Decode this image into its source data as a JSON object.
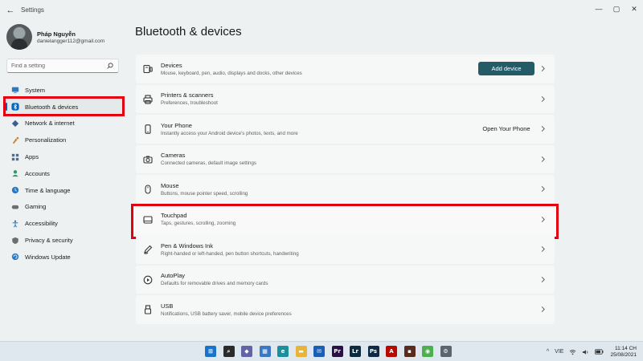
{
  "window": {
    "title": "Settings",
    "back_glyph": "←",
    "minimize_glyph": "—",
    "maximize_glyph": "▢",
    "close_glyph": "✕"
  },
  "profile": {
    "name": "Pháp Nguyễn",
    "email": "danielangger112@gmail.com"
  },
  "search": {
    "placeholder": "Find a setting"
  },
  "sidebar": {
    "items": [
      {
        "label": "System",
        "icon": "system-icon",
        "color": "#2b79c2"
      },
      {
        "label": "Bluetooth & devices",
        "icon": "bluetooth-icon",
        "color": "#0067c0",
        "selected": true
      },
      {
        "label": "Network & internet",
        "icon": "network-icon",
        "color": "#3a5f8c"
      },
      {
        "label": "Personalization",
        "icon": "personalization-icon",
        "color": "#c5892e"
      },
      {
        "label": "Apps",
        "icon": "apps-icon",
        "color": "#4f6d8c"
      },
      {
        "label": "Accounts",
        "icon": "accounts-icon",
        "color": "#2f9a6a"
      },
      {
        "label": "Time & language",
        "icon": "time-language-icon",
        "color": "#2b79c2"
      },
      {
        "label": "Gaming",
        "icon": "gaming-icon",
        "color": "#6c6f72"
      },
      {
        "label": "Accessibility",
        "icon": "accessibility-icon",
        "color": "#2b79c2"
      },
      {
        "label": "Privacy & security",
        "icon": "privacy-icon",
        "color": "#6c6f72"
      },
      {
        "label": "Windows Update",
        "icon": "windows-update-icon",
        "color": "#2b79c2"
      }
    ]
  },
  "main": {
    "title": "Bluetooth & devices",
    "cards": [
      {
        "title": "Devices",
        "desc": "Mouse, keyboard, pen, audio, displays and docks, other devices",
        "icon": "devices-icon",
        "button": "Add device",
        "button_style": "accent"
      },
      {
        "title": "Printers & scanners",
        "desc": "Preferences, troubleshoot",
        "icon": "printer-icon"
      },
      {
        "title": "Your Phone",
        "desc": "Instantly access your Android device's photos, texts, and more",
        "icon": "phone-icon",
        "button": "Open Your Phone",
        "button_style": "plain"
      },
      {
        "title": "Cameras",
        "desc": "Connected cameras, default image settings",
        "icon": "camera-icon"
      },
      {
        "title": "Mouse",
        "desc": "Buttons, mouse pointer speed, scrolling",
        "icon": "mouse-icon"
      },
      {
        "title": "Touchpad",
        "desc": "Taps, gestures, scrolling, zooming",
        "icon": "touchpad-icon",
        "highlighted": true
      },
      {
        "title": "Pen & Windows Ink",
        "desc": "Right-handed or left-handed, pen button shortcuts, handwriting",
        "icon": "pen-icon"
      },
      {
        "title": "AutoPlay",
        "desc": "Defaults for removable drives and memory cards",
        "icon": "autoplay-icon"
      },
      {
        "title": "USB",
        "desc": "Notifications, USB battery saver, mobile device preferences",
        "icon": "usb-icon"
      }
    ]
  },
  "taskbar": {
    "apps": [
      {
        "name": "start-icon",
        "color": "#1a73c8",
        "glyph": "⊞"
      },
      {
        "name": "taskbar-search-icon",
        "color": "#2b2b2b",
        "glyph": "⌕"
      },
      {
        "name": "teams-chat-icon",
        "color": "#6264a7",
        "glyph": "◆"
      },
      {
        "name": "widgets-icon",
        "color": "#3b78c2",
        "glyph": "▦"
      },
      {
        "name": "edge-icon",
        "color": "#1b8f9c",
        "glyph": "e"
      },
      {
        "name": "file-explorer-icon",
        "color": "#e8b33a",
        "glyph": "▬"
      },
      {
        "name": "mail-icon",
        "color": "#1a5fb4",
        "glyph": "✉"
      },
      {
        "name": "premiere-icon",
        "color": "#2a1143",
        "glyph": "Pr"
      },
      {
        "name": "lightroom-icon",
        "color": "#0e2a3d",
        "glyph": "Lr"
      },
      {
        "name": "photoshop-icon",
        "color": "#0f2a45",
        "glyph": "Ps"
      },
      {
        "name": "acrobat-icon",
        "color": "#b30b00",
        "glyph": "A"
      },
      {
        "name": "app-icon",
        "color": "#5b2a1e",
        "glyph": "▪"
      },
      {
        "name": "chrome-icon",
        "color": "#4caf50",
        "glyph": "◉"
      },
      {
        "name": "settings-app-icon",
        "color": "#5a6570",
        "glyph": "⚙"
      }
    ],
    "tray": {
      "chevron": "^",
      "language": "VIE",
      "wifi": "wifi-icon",
      "volume": "volume-icon",
      "battery": "battery-icon",
      "time": "11:14 CH",
      "date": "25/08/2021"
    }
  },
  "colors": {
    "accent": "#235b67",
    "highlight": "#e3000f",
    "selection_bar": "#005fb8"
  }
}
